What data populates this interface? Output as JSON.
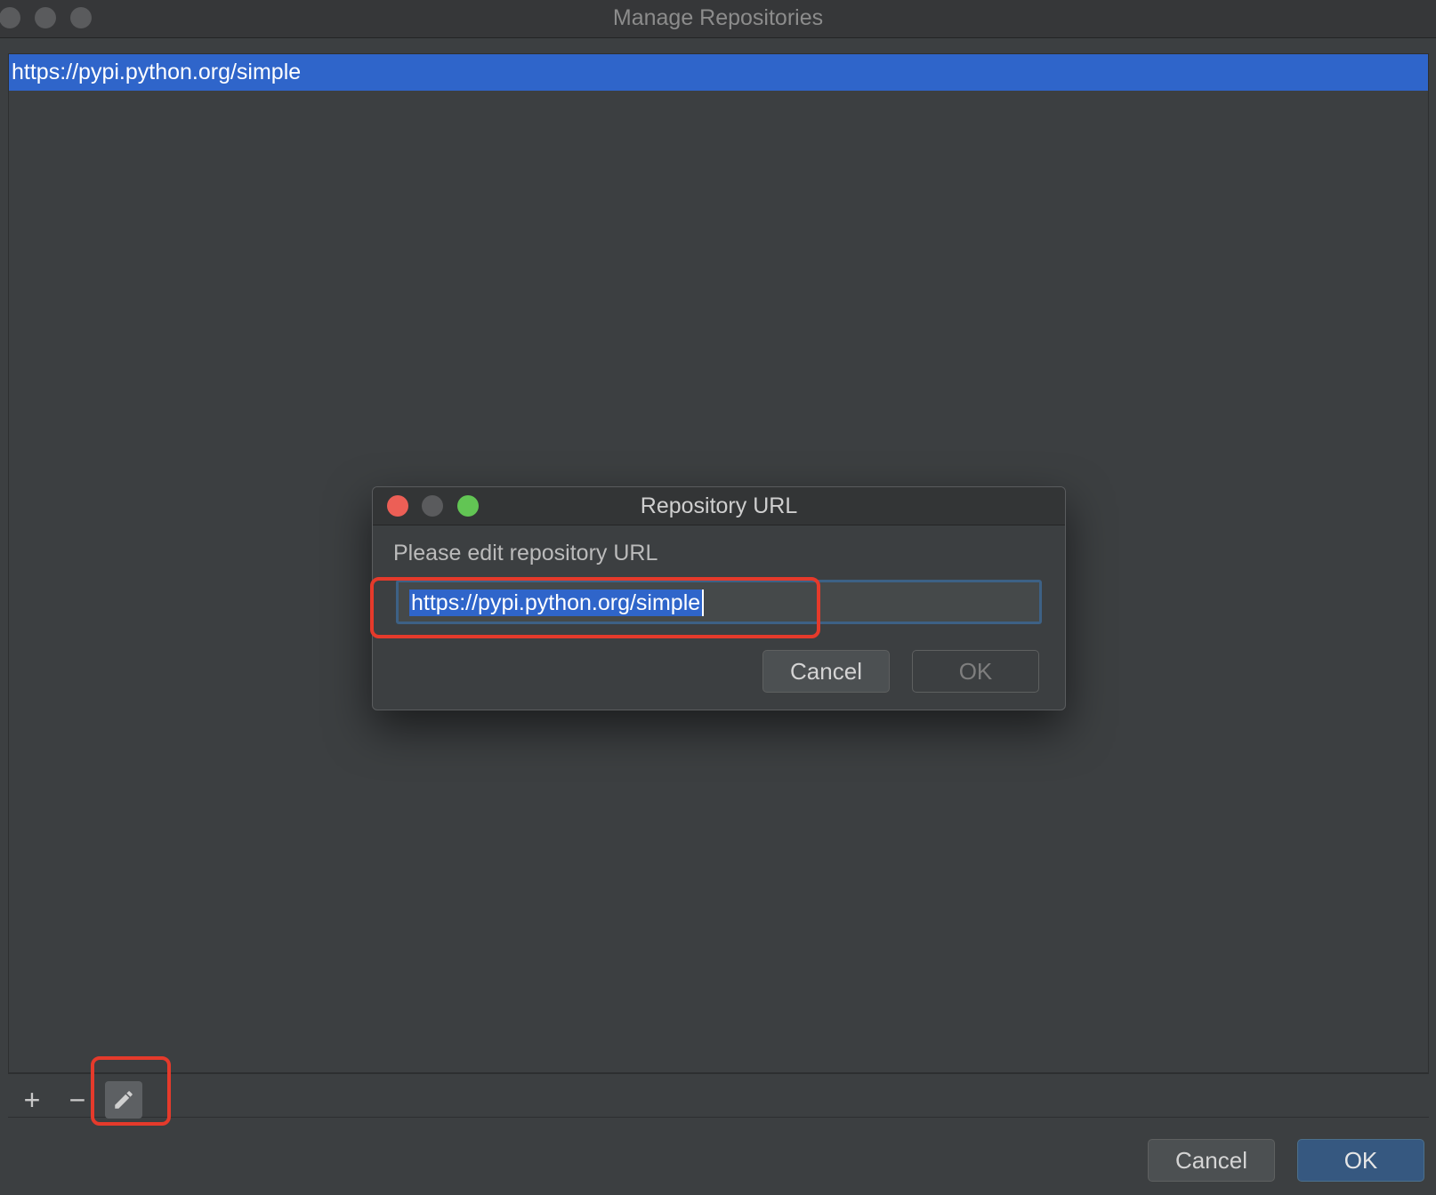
{
  "window": {
    "title": "Manage Repositories"
  },
  "list": {
    "items": [
      {
        "url": "https://pypi.python.org/simple",
        "selected": true
      }
    ]
  },
  "toolbar": {
    "add_symbol": "+",
    "remove_symbol": "−"
  },
  "footer": {
    "cancel_label": "Cancel",
    "ok_label": "OK"
  },
  "dialog": {
    "title": "Repository URL",
    "prompt": "Please edit repository URL",
    "url_value": "https://pypi.python.org/simple",
    "cancel_label": "Cancel",
    "ok_label": "OK"
  },
  "colors": {
    "selection": "#2f65ca",
    "highlight_box": "#e53a2b",
    "close_light": "#ec5f56",
    "minimize_light": "#5a5b5d",
    "zoom_light": "#62c554"
  }
}
